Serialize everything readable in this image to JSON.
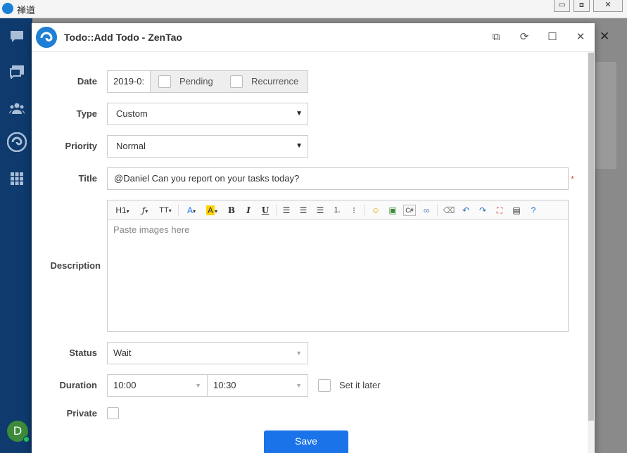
{
  "os": {
    "title": "禅道",
    "buttons": [
      "▭",
      "⧈",
      "✕"
    ]
  },
  "modal": {
    "title": "Todo::Add Todo - ZenTao",
    "header_buttons": [
      "⧉",
      "⟳",
      "☐",
      "✕"
    ]
  },
  "form": {
    "date": {
      "label": "Date",
      "value": "2019-0:",
      "pending_label": "Pending",
      "recurrence_label": "Recurrence"
    },
    "type": {
      "label": "Type",
      "value": "Custom"
    },
    "priority": {
      "label": "Priority",
      "value": "Normal"
    },
    "title": {
      "label": "Title",
      "value": "@Daniel Can you report on your tasks today?",
      "required_mark": "*"
    },
    "description": {
      "label": "Description",
      "placeholder": "Paste images here",
      "toolbar": {
        "heading": "H1",
        "font": "ƒ",
        "fontsize": "TT",
        "font_color": "A",
        "bg_color": "A",
        "bold": "B",
        "italic": "I",
        "underline": "U"
      }
    },
    "status": {
      "label": "Status",
      "value": "Wait"
    },
    "duration": {
      "label": "Duration",
      "start": "10:00",
      "end": "10:30",
      "later_label": "Set it later"
    },
    "private": {
      "label": "Private"
    },
    "save_label": "Save"
  },
  "sidebar": {
    "avatar_initial": "D"
  },
  "colors": {
    "sidebar": "#0e3a6d",
    "primary": "#1a73e8",
    "required": "#d9534f"
  }
}
